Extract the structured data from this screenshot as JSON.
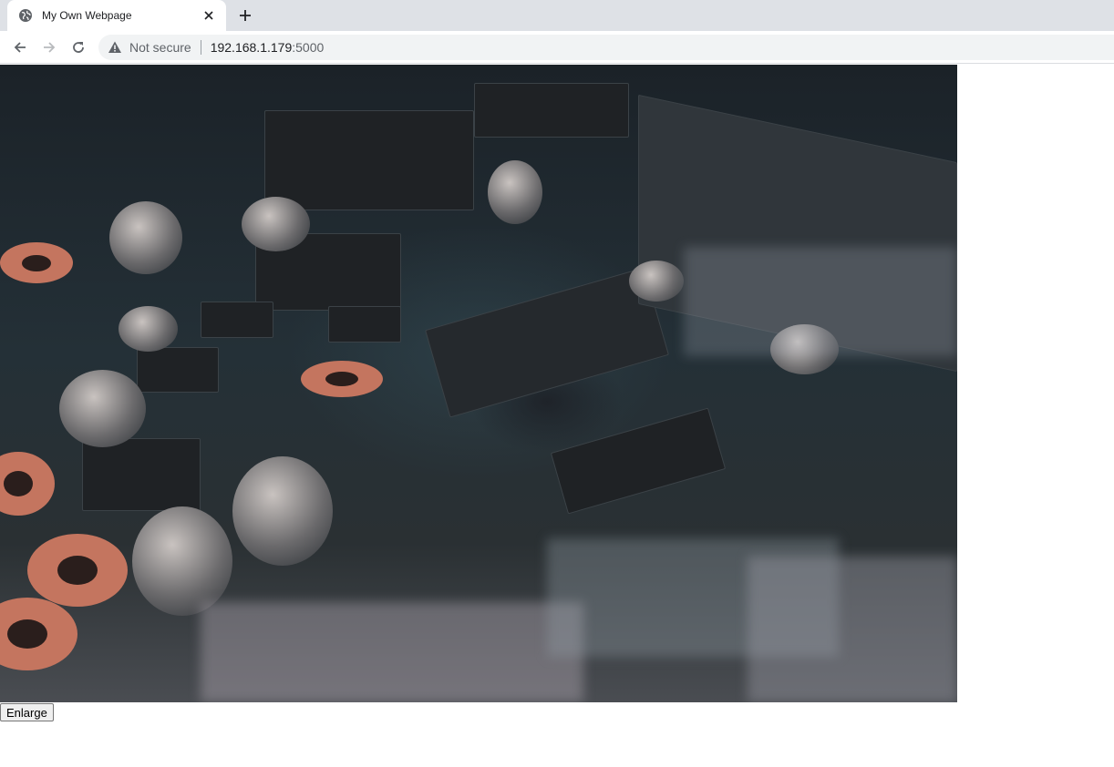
{
  "browser": {
    "tab": {
      "title": "My Own Webpage",
      "favicon": "globe-icon"
    },
    "address_bar": {
      "security_label": "Not secure",
      "host": "192.168.1.179",
      "port": ":5000"
    }
  },
  "page": {
    "image": {
      "subject": "circuit-board-photo"
    },
    "enlarge_button": {
      "label": "Enlarge"
    }
  },
  "colors": {
    "tabstrip_bg": "#dee1e6",
    "omnibox_bg": "#f1f3f4"
  }
}
